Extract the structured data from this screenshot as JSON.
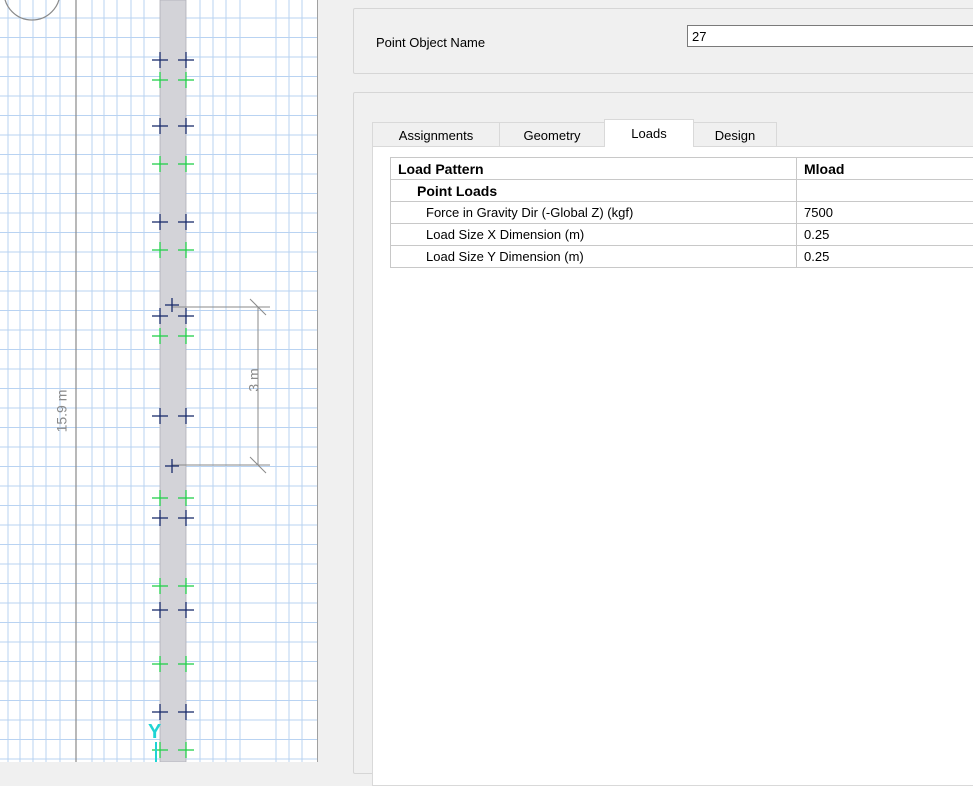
{
  "model_view": {
    "dimensions": [
      {
        "label": "15.9 m"
      },
      {
        "label": "3 m"
      }
    ],
    "axis_label": "Y",
    "colors": {
      "grid": "#b9d3f2",
      "column": "#d3d3d8",
      "node_dark": "#1a2c6b",
      "node_green": "#22d04a",
      "axis": "#1fd4d4",
      "dimension": "#8a8a8a"
    }
  },
  "panel": {
    "name_label": "Point Object Name",
    "name_value": "27",
    "tabs": [
      {
        "label": "Assignments",
        "active": false
      },
      {
        "label": "Geometry",
        "active": false
      },
      {
        "label": "Loads",
        "active": true
      },
      {
        "label": "Design",
        "active": false
      }
    ],
    "grid": {
      "header": {
        "property": "Load Pattern",
        "value": "Mload"
      },
      "section": {
        "property": "Point Loads",
        "value": ""
      },
      "rows": [
        {
          "property": "Force in Gravity Dir (-Global Z)  (kgf)",
          "value": "7500"
        },
        {
          "property": "Load Size X Dimension  (m)",
          "value": "0.25"
        },
        {
          "property": "Load Size Y Dimension  (m)",
          "value": "0.25"
        }
      ]
    }
  }
}
